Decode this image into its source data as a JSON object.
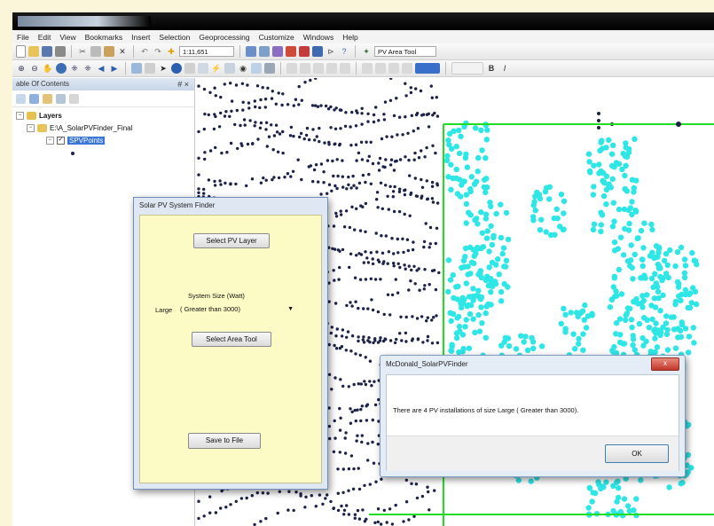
{
  "window": {
    "title": ""
  },
  "menu": [
    "File",
    "Edit",
    "View",
    "Bookmarks",
    "Insert",
    "Selection",
    "Geoprocessing",
    "Customize",
    "Windows",
    "Help"
  ],
  "toolbar": {
    "scale": "1:11,651",
    "tool_combo": "PV Area Tool"
  },
  "toc": {
    "title": "able Of Contents",
    "close": "# ×",
    "layers_label": "Layers",
    "group_label": "E:\\A_SolarPVFinder_Final",
    "layer_label": "SPVPoints"
  },
  "finder_dialog": {
    "title": "Solar PV System Finder",
    "select_layer_button": "Select PV Layer",
    "system_size_label": "System Size (Watt)",
    "size_name": "Large",
    "size_option": "( Greater than 3000)",
    "select_area_button": "Select Area Tool",
    "save_button": "Save to File"
  },
  "message_box": {
    "title": "McDonald_SolarPVFinder",
    "close": "x",
    "message": "There are 4 PV installations of size Large     ( Greater than 3000).",
    "ok": "OK"
  },
  "colors": {
    "selected_points": "#2ee6e6",
    "unselected_points": "#1c2248",
    "selection_box": "#22dd22",
    "dialog_background": "#fcfbc6"
  }
}
